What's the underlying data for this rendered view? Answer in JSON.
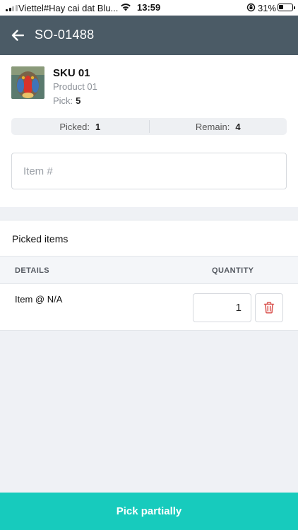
{
  "status_bar": {
    "carrier": "Viettel#Hay cai dat Blu...",
    "time": "13:59",
    "battery": "31%"
  },
  "header": {
    "title": "SO-01488",
    "back_icon": "arrow-left-icon"
  },
  "product": {
    "sku": "SKU 01",
    "name": "Product 01",
    "pick_label": "Pick:",
    "pick_value": "5"
  },
  "stats": {
    "picked_label": "Picked:",
    "picked_value": "1",
    "remain_label": "Remain:",
    "remain_value": "4"
  },
  "item_input": {
    "placeholder": "Item #",
    "value": ""
  },
  "picked_items": {
    "title": "Picked items",
    "columns": [
      "DETAILS",
      "QUANTITY"
    ],
    "rows": [
      {
        "details": "Item @ N/A",
        "quantity": "1"
      }
    ]
  },
  "footer": {
    "button_label": "Pick partially"
  },
  "colors": {
    "header_bg": "#4b5b66",
    "accent": "#17cbbd",
    "delete": "#d9534f"
  }
}
